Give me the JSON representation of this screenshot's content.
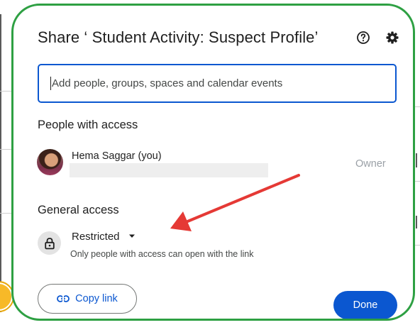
{
  "dialog": {
    "title": "Share ‘ Student Activity: Suspect Profile’",
    "help_icon": "help-circle-icon",
    "settings_icon": "gear-icon",
    "add_input": {
      "placeholder": "Add people, groups, spaces and calendar events",
      "value": ""
    },
    "people_section": {
      "heading": "People with access",
      "people": [
        {
          "name": "Hema Saggar (you)",
          "role": "Owner"
        }
      ]
    },
    "general_access": {
      "heading": "General access",
      "selected": "Restricted",
      "description": "Only people with access can open with the link",
      "icon": "lock-icon"
    },
    "footer": {
      "copy_link_label": "Copy link",
      "copy_link_icon": "link-icon",
      "done_label": "Done"
    }
  },
  "colors": {
    "accent_blue": "#0b57d0",
    "border_green": "#2ea043",
    "annotation_red": "#e53935",
    "badge_yellow": "#f7b928"
  }
}
